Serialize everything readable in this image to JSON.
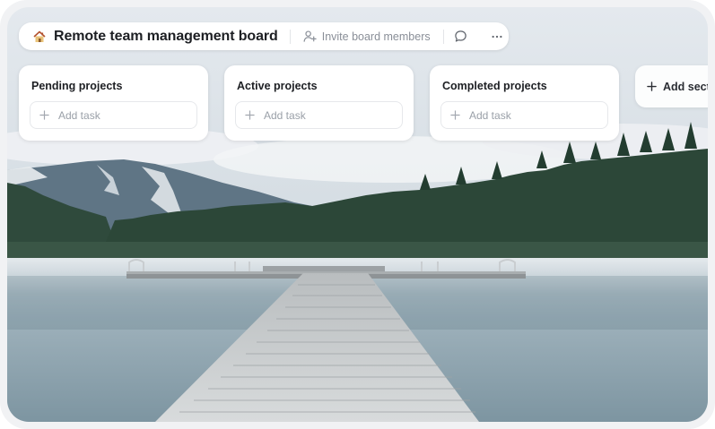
{
  "board": {
    "emoji": "house-icon",
    "title": "Remote team management board",
    "invite_label": "Invite board members",
    "comment_icon": "comment-icon",
    "more_icon": "more-dots-icon"
  },
  "columns": [
    {
      "title": "Pending projects",
      "add_task_label": "Add task"
    },
    {
      "title": "Active projects",
      "add_task_label": "Add task"
    },
    {
      "title": "Completed projects",
      "add_task_label": "Add task"
    }
  ],
  "add_section_label": "Add section",
  "colors": {
    "title_text": "#1d1f23",
    "muted_text": "#8a8f98",
    "card_bg": "#ffffff",
    "frame_bg": "#f1f2f4"
  }
}
